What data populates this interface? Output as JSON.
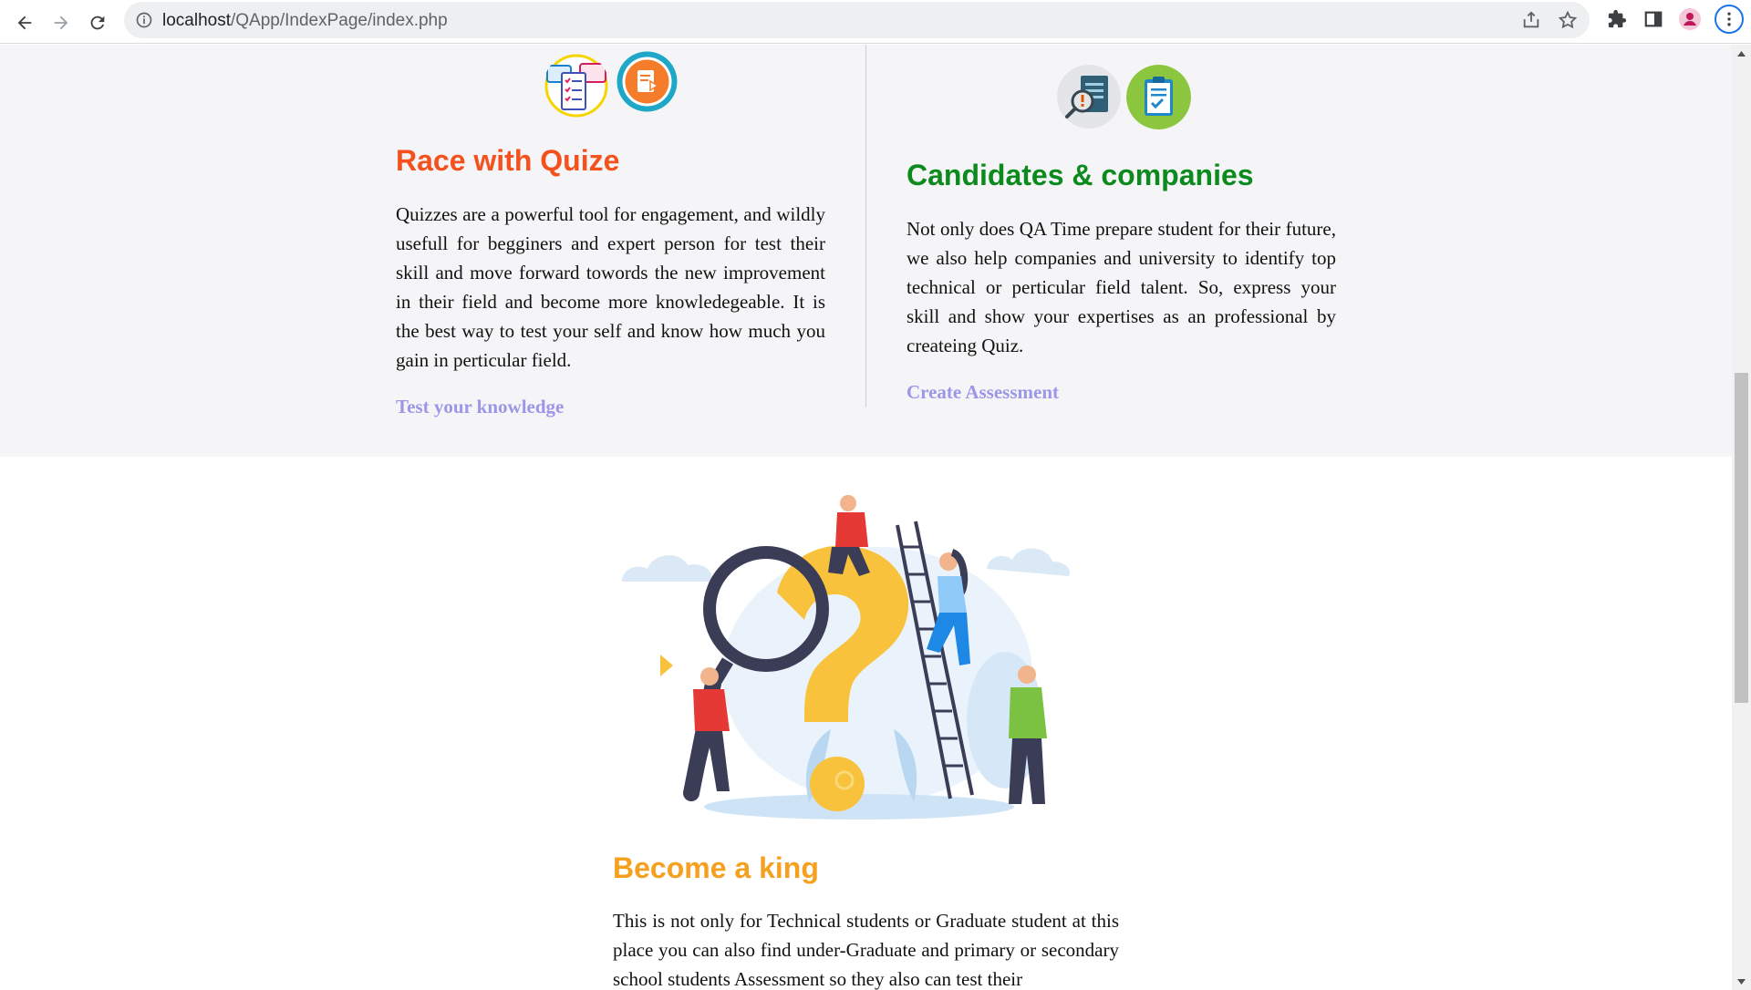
{
  "browser": {
    "url_host": "localhost",
    "url_path": "/QApp/IndexPage/index.php"
  },
  "features": [
    {
      "title": "Race with Quize",
      "title_color": "#f4511e",
      "text": "Quizzes are a powerful tool for engagement, and wildly usefull for begginers and expert person for test their skill and move forward towords the new improvement in their field and become more knowledegeable. It is the best way to test your self and know how much you gain in perticular field.",
      "link": "Test your knowledge",
      "icons": [
        "quiz-chat-checklist-icon",
        "play-document-icon"
      ]
    },
    {
      "title": "Candidates & companies",
      "title_color": "#0c8a1e",
      "text": "Not only does QA Time prepare student for their future, we also help companies and university to identify top technical or perticular field talent. So, express your skill and show your expertises as an professional by createing Quiz.",
      "link": "Create Assessment",
      "icons": [
        "search-document-icon",
        "clipboard-checklist-icon"
      ]
    }
  ],
  "king": {
    "title": "Become a king",
    "text": "This is not only for Technical students or Graduate student at this place you can also find under-Graduate and primary or secondary school students Assessment so they also can test their"
  },
  "colors": {
    "link": "#9b96e8",
    "king_title": "#f5a01f",
    "section_bg": "#f5f5f7"
  }
}
